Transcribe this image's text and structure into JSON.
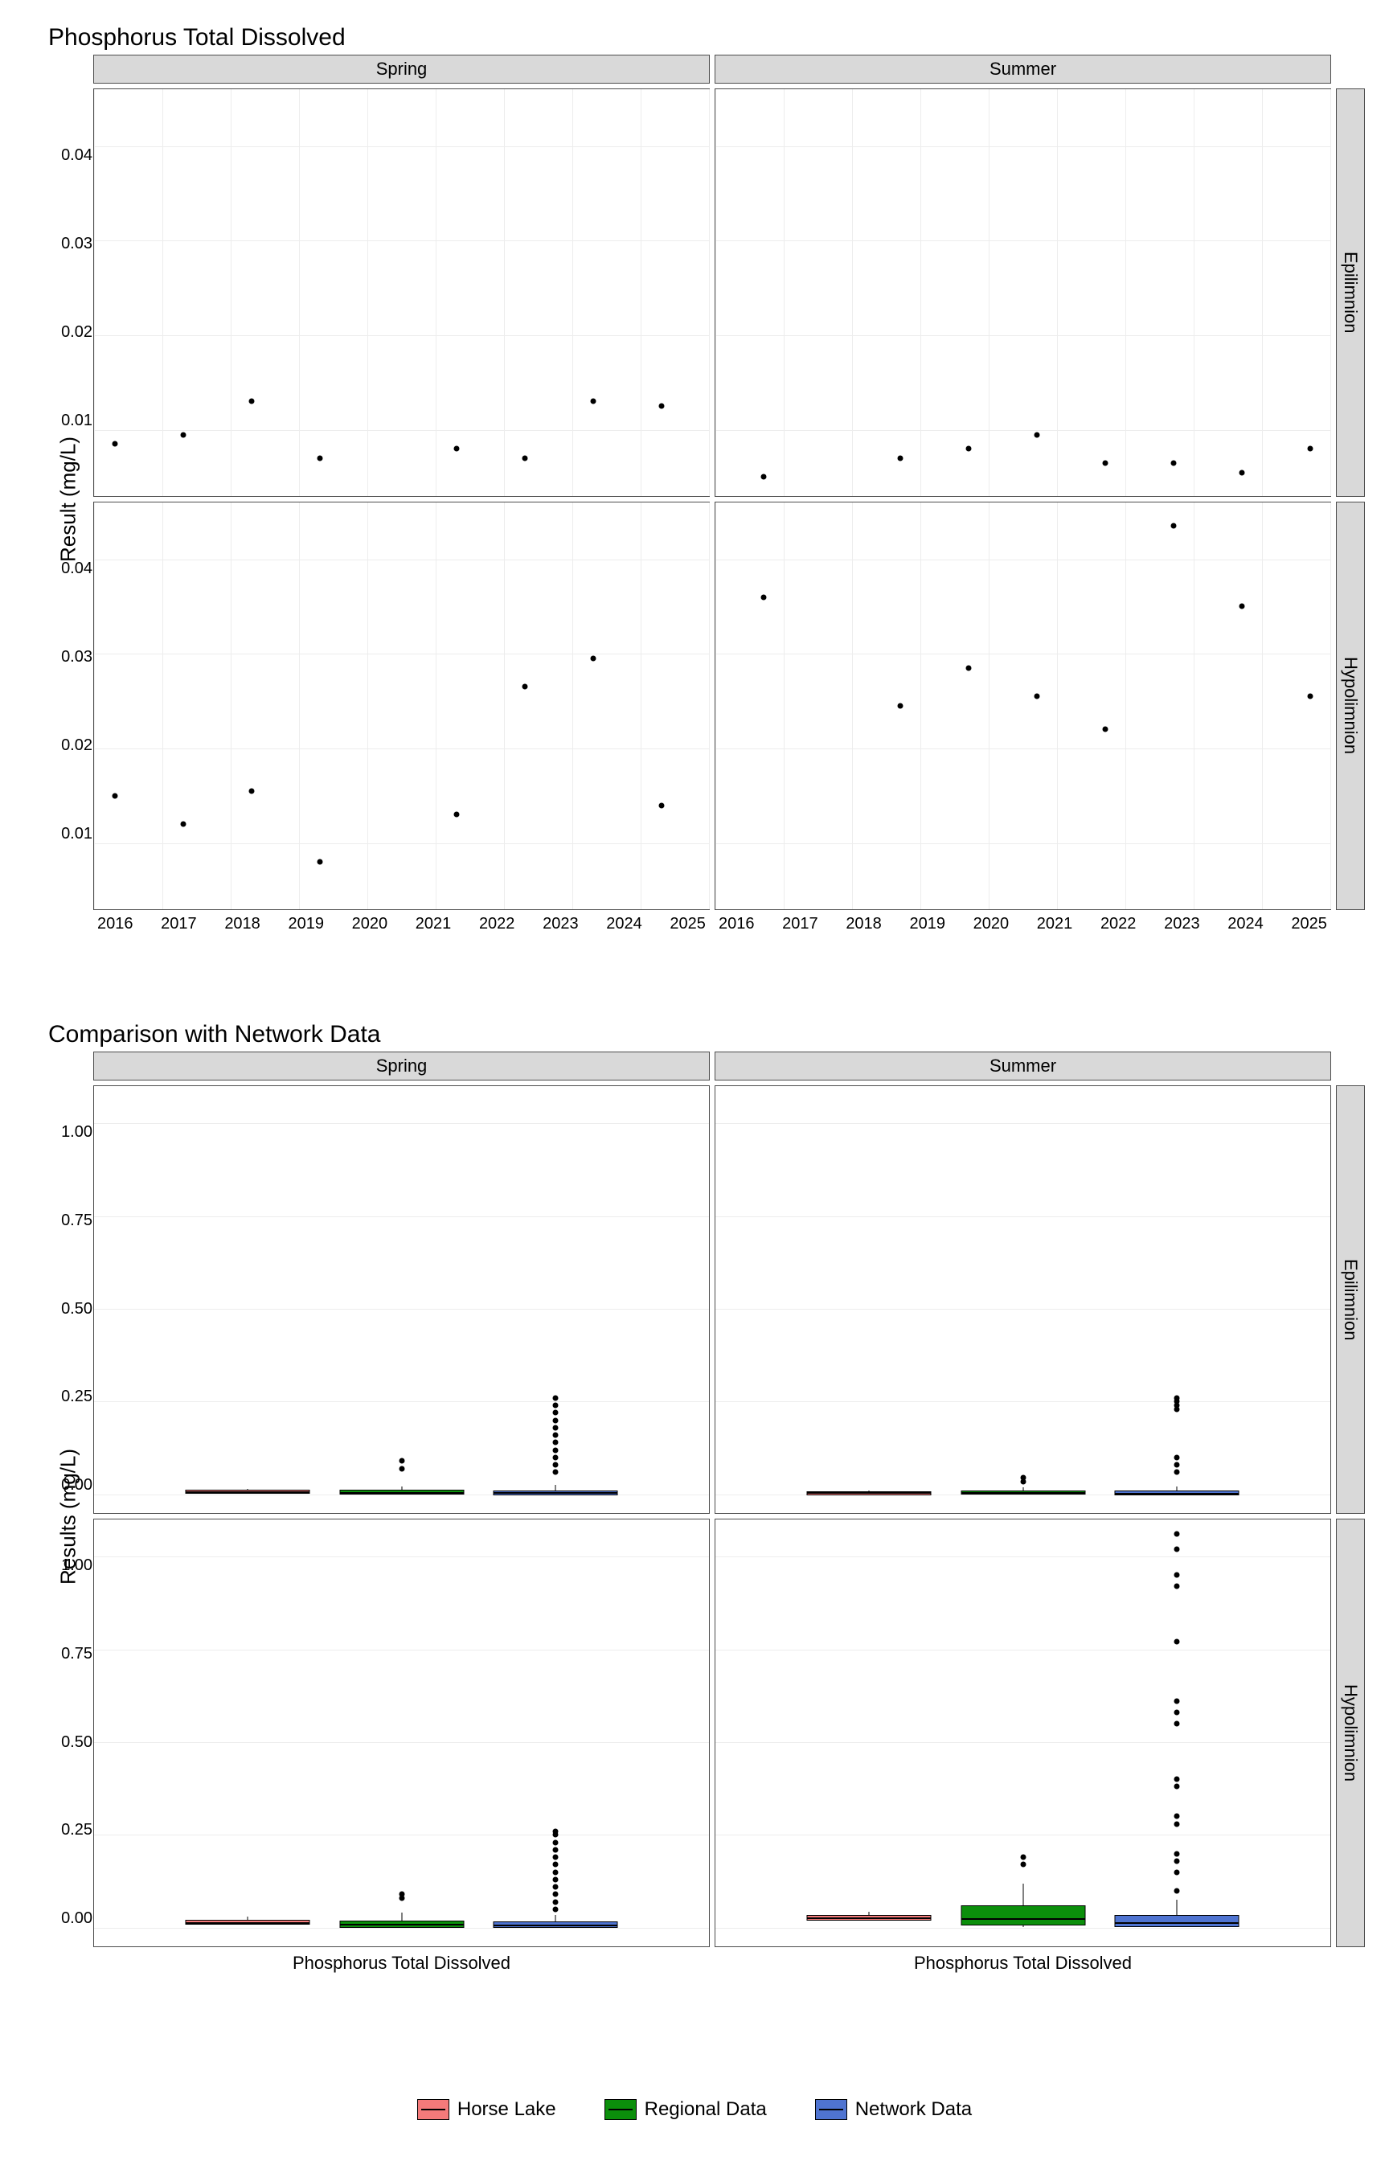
{
  "chart_data": [
    {
      "type": "scatter",
      "title": "Phosphorus Total Dissolved",
      "ylabel": "Result (mg/L)",
      "facets_col": [
        "Spring",
        "Summer"
      ],
      "facets_row": [
        "Epilimnion",
        "Hypolimnion"
      ],
      "x_ticks": [
        "2016",
        "2017",
        "2018",
        "2019",
        "2020",
        "2021",
        "2022",
        "2023",
        "2024",
        "2025"
      ],
      "y_ticks": [
        "0.01",
        "0.02",
        "0.03",
        "0.04"
      ],
      "xlim": [
        2016,
        2025
      ],
      "ylim": [
        0.003,
        0.046
      ],
      "series": [
        {
          "facet_col": "Spring",
          "facet_row": "Epilimnion",
          "points": [
            {
              "x": 2016.3,
              "y": 0.0085
            },
            {
              "x": 2017.3,
              "y": 0.0095
            },
            {
              "x": 2018.3,
              "y": 0.013
            },
            {
              "x": 2019.3,
              "y": 0.007
            },
            {
              "x": 2021.3,
              "y": 0.008
            },
            {
              "x": 2022.3,
              "y": 0.007
            },
            {
              "x": 2023.3,
              "y": 0.013
            },
            {
              "x": 2024.3,
              "y": 0.0125
            }
          ]
        },
        {
          "facet_col": "Summer",
          "facet_row": "Epilimnion",
          "points": [
            {
              "x": 2016.7,
              "y": 0.005
            },
            {
              "x": 2018.7,
              "y": 0.007
            },
            {
              "x": 2019.7,
              "y": 0.008
            },
            {
              "x": 2020.7,
              "y": 0.0095
            },
            {
              "x": 2021.7,
              "y": 0.0065
            },
            {
              "x": 2022.7,
              "y": 0.0065
            },
            {
              "x": 2023.7,
              "y": 0.0055
            },
            {
              "x": 2024.7,
              "y": 0.008
            }
          ]
        },
        {
          "facet_col": "Spring",
          "facet_row": "Hypolimnion",
          "points": [
            {
              "x": 2016.3,
              "y": 0.015
            },
            {
              "x": 2017.3,
              "y": 0.012
            },
            {
              "x": 2018.3,
              "y": 0.0155
            },
            {
              "x": 2019.3,
              "y": 0.008
            },
            {
              "x": 2021.3,
              "y": 0.013
            },
            {
              "x": 2022.3,
              "y": 0.0265
            },
            {
              "x": 2023.3,
              "y": 0.0295
            },
            {
              "x": 2024.3,
              "y": 0.014
            }
          ]
        },
        {
          "facet_col": "Summer",
          "facet_row": "Hypolimnion",
          "points": [
            {
              "x": 2016.7,
              "y": 0.036
            },
            {
              "x": 2018.7,
              "y": 0.0245
            },
            {
              "x": 2019.7,
              "y": 0.0285
            },
            {
              "x": 2020.7,
              "y": 0.0255
            },
            {
              "x": 2021.7,
              "y": 0.022
            },
            {
              "x": 2022.7,
              "y": 0.0435
            },
            {
              "x": 2023.7,
              "y": 0.035
            },
            {
              "x": 2024.7,
              "y": 0.0255
            }
          ]
        }
      ]
    },
    {
      "type": "boxplot",
      "title": "Comparison with Network Data",
      "ylabel": "Results (mg/L)",
      "facets_col": [
        "Spring",
        "Summer"
      ],
      "facets_row": [
        "Epilimnion",
        "Hypolimnion"
      ],
      "x_category_label": "Phosphorus Total Dissolved",
      "y_ticks": [
        "0.00",
        "0.25",
        "0.50",
        "0.75",
        "1.00"
      ],
      "ylim": [
        -0.05,
        1.1
      ],
      "legend": [
        {
          "label": "Horse Lake",
          "color": "red"
        },
        {
          "label": "Regional Data",
          "color": "green"
        },
        {
          "label": "Network Data",
          "color": "blue"
        }
      ],
      "boxes": [
        {
          "facet_col": "Spring",
          "facet_row": "Epilimnion",
          "group": "Horse Lake",
          "q1": 0.007,
          "median": 0.009,
          "q3": 0.013,
          "low": 0.005,
          "high": 0.015,
          "outliers": []
        },
        {
          "facet_col": "Spring",
          "facet_row": "Epilimnion",
          "group": "Regional Data",
          "q1": 0.004,
          "median": 0.007,
          "q3": 0.012,
          "low": 0.001,
          "high": 0.022,
          "outliers": [
            0.07,
            0.09
          ]
        },
        {
          "facet_col": "Spring",
          "facet_row": "Epilimnion",
          "group": "Network Data",
          "q1": 0.003,
          "median": 0.006,
          "q3": 0.011,
          "low": 0.001,
          "high": 0.025,
          "outliers": [
            0.06,
            0.08,
            0.1,
            0.12,
            0.14,
            0.16,
            0.18,
            0.2,
            0.22,
            0.24,
            0.26
          ]
        },
        {
          "facet_col": "Summer",
          "facet_row": "Epilimnion",
          "group": "Horse Lake",
          "q1": 0.006,
          "median": 0.007,
          "q3": 0.008,
          "low": 0.005,
          "high": 0.01,
          "outliers": []
        },
        {
          "facet_col": "Summer",
          "facet_row": "Epilimnion",
          "group": "Regional Data",
          "q1": 0.004,
          "median": 0.006,
          "q3": 0.01,
          "low": 0.001,
          "high": 0.02,
          "outliers": [
            0.035,
            0.045
          ]
        },
        {
          "facet_col": "Summer",
          "facet_row": "Epilimnion",
          "group": "Network Data",
          "q1": 0.003,
          "median": 0.005,
          "q3": 0.01,
          "low": 0.001,
          "high": 0.022,
          "outliers": [
            0.06,
            0.08,
            0.1,
            0.23,
            0.24,
            0.25,
            0.26
          ]
        },
        {
          "facet_col": "Spring",
          "facet_row": "Hypolimnion",
          "group": "Horse Lake",
          "q1": 0.012,
          "median": 0.015,
          "q3": 0.021,
          "low": 0.008,
          "high": 0.03,
          "outliers": []
        },
        {
          "facet_col": "Spring",
          "facet_row": "Hypolimnion",
          "group": "Regional Data",
          "q1": 0.005,
          "median": 0.01,
          "q3": 0.02,
          "low": 0.001,
          "high": 0.04,
          "outliers": [
            0.08,
            0.09
          ]
        },
        {
          "facet_col": "Spring",
          "facet_row": "Hypolimnion",
          "group": "Network Data",
          "q1": 0.004,
          "median": 0.008,
          "q3": 0.018,
          "low": 0.001,
          "high": 0.035,
          "outliers": [
            0.05,
            0.07,
            0.09,
            0.11,
            0.13,
            0.15,
            0.17,
            0.19,
            0.21,
            0.23,
            0.25,
            0.26
          ]
        },
        {
          "facet_col": "Summer",
          "facet_row": "Hypolimnion",
          "group": "Horse Lake",
          "q1": 0.024,
          "median": 0.028,
          "q3": 0.035,
          "low": 0.022,
          "high": 0.044,
          "outliers": []
        },
        {
          "facet_col": "Summer",
          "facet_row": "Hypolimnion",
          "group": "Regional Data",
          "q1": 0.01,
          "median": 0.025,
          "q3": 0.06,
          "low": 0.001,
          "high": 0.12,
          "outliers": [
            0.17,
            0.19
          ]
        },
        {
          "facet_col": "Summer",
          "facet_row": "Hypolimnion",
          "group": "Network Data",
          "q1": 0.006,
          "median": 0.015,
          "q3": 0.035,
          "low": 0.001,
          "high": 0.075,
          "outliers": [
            0.1,
            0.15,
            0.18,
            0.2,
            0.28,
            0.3,
            0.38,
            0.4,
            0.55,
            0.58,
            0.61,
            0.77,
            0.92,
            0.95,
            1.02,
            1.06
          ]
        }
      ]
    }
  ]
}
